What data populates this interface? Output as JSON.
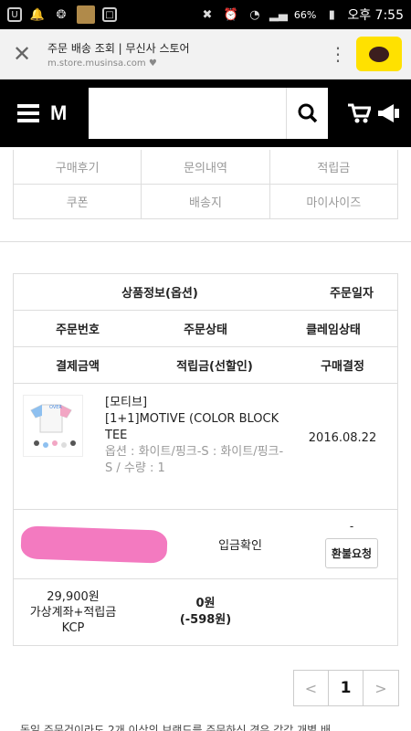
{
  "status_bar": {
    "battery": "66%",
    "time": "오후 7:55"
  },
  "browser": {
    "page_title": "주문 배송 조회 | 무신사 스토어",
    "url": "m.store.musinsa.com"
  },
  "header": {
    "brand": "M"
  },
  "menu": {
    "items": [
      "구매후기",
      "문의내역",
      "적립금",
      "쿠폰",
      "배송지",
      "마이사이즈"
    ]
  },
  "order_table": {
    "header_row1": [
      "상품정보(옵션)",
      "주문일자"
    ],
    "header_row2": [
      "주문번호",
      "주문상태",
      "클레임상태"
    ],
    "header_row3": [
      "결제금액",
      "적립금(선할인)",
      "구매결정"
    ],
    "product": {
      "brand": "[모티브]",
      "name": "[1+1]MOTIVE (COLOR BLOCK TEE",
      "option": "옵션 : 화이트/핑크-S : 화이트/핑크-S / 수량 : 1",
      "date": "2016.08.22"
    },
    "status": "입금확인",
    "claim": "-",
    "refund_button": "환불요청",
    "payment_amount": "29,900원",
    "payment_method": "가상계좌+적립금",
    "payment_pg": "KCP",
    "points": "0원",
    "points_discount": "(-598원)"
  },
  "pagination": {
    "prev": "<",
    "current": "1",
    "next": ">"
  },
  "footnote": "동일 주문건이라도 2개 이상의 브랜드를 주문하신 경우 각각 개별 배"
}
